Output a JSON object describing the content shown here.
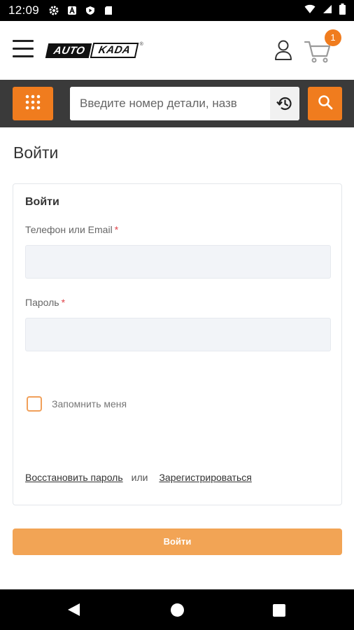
{
  "status_bar": {
    "time": "12:09",
    "icons": [
      "gear-icon",
      "a-icon",
      "shield-play-icon",
      "sd-card-icon"
    ],
    "right_icons": [
      "wifi-icon",
      "signal-icon",
      "battery-icon"
    ]
  },
  "header": {
    "logo": {
      "part1": "AUTO",
      "part2": "KADA",
      "tm": "®"
    },
    "cart_count": "1",
    "accent_color": "#f07c1e"
  },
  "search": {
    "placeholder": "Введите номер детали, назв"
  },
  "page": {
    "title": "Войти"
  },
  "form": {
    "title": "Войти",
    "phone_label": "Телефон или Email",
    "password_label": "Пароль",
    "required_mark": "*",
    "phone_value": "",
    "password_value": "",
    "remember_label": "Запомнить меня",
    "remember_checked": false,
    "restore_link": "Восстановить пароль",
    "or_text": "или",
    "register_link": "Зарегистрироваться",
    "submit_label": "Войти"
  }
}
